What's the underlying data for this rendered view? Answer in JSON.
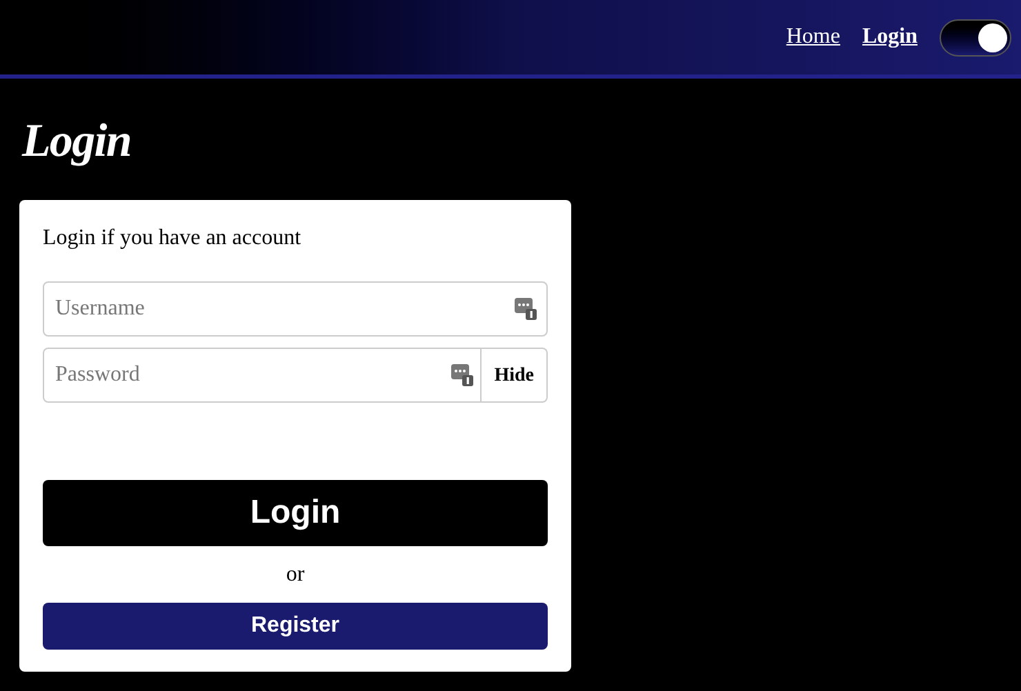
{
  "nav": {
    "links": [
      {
        "label": "Home",
        "selected": false
      },
      {
        "label": "Login",
        "selected": true
      }
    ],
    "theme_toggle": {
      "on": true
    }
  },
  "heading": "Login",
  "form": {
    "intro": "Login if you have an account",
    "username": {
      "placeholder": "Username"
    },
    "password": {
      "placeholder": "Password",
      "toggle_label": "Hide"
    },
    "login_button": "Login",
    "separator": "or",
    "register_button": "Register"
  }
}
